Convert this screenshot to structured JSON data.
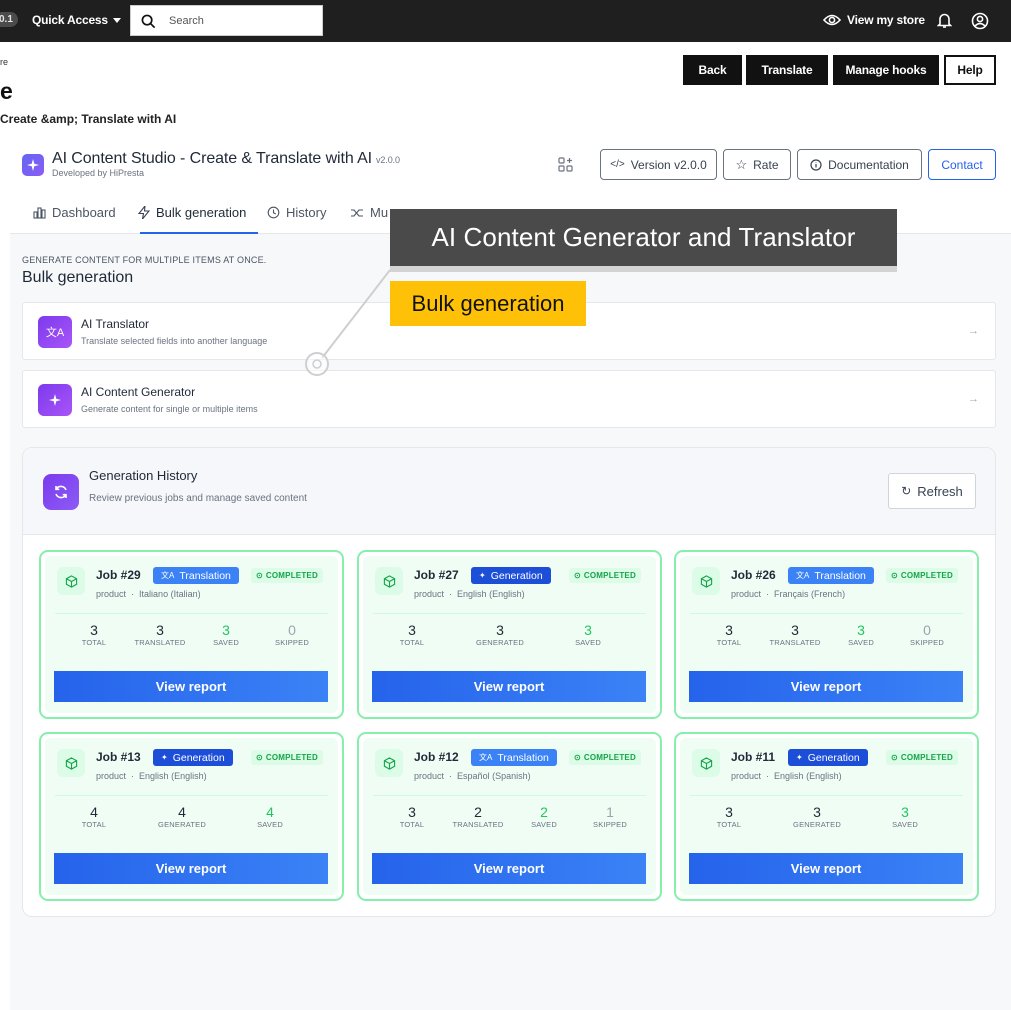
{
  "topbar": {
    "version_badge": "0.1",
    "quick_access": "Quick Access",
    "search_placeholder": "Search",
    "view_store": "View my store"
  },
  "header": {
    "breadcrumb": "re",
    "title": "e",
    "subtitle": "Create &amp; Translate with AI",
    "buttons": [
      "Back",
      "Translate",
      "Manage hooks",
      "Help"
    ]
  },
  "module": {
    "title": "AI Content Studio - Create & Translate with AI",
    "version": "v2.0.0",
    "developer": "Developed by HiPresta",
    "actions": {
      "version_label": "Version v2.0.0",
      "rate_label": "Rate",
      "docs_label": "Documentation",
      "contact_label": "Contact"
    }
  },
  "tabs": [
    {
      "label": "Dashboard",
      "icon": "chart-icon"
    },
    {
      "label": "Bulk generation",
      "icon": "bolt-icon",
      "active": true
    },
    {
      "label": "History",
      "icon": "history-icon"
    },
    {
      "label": "Mu",
      "icon": "shuffle-icon"
    }
  ],
  "section": {
    "kicker": "GENERATE CONTENT FOR MULTIPLE ITEMS AT ONCE.",
    "title": "Bulk generation",
    "cards": [
      {
        "title": "AI Translator",
        "desc": "Translate selected fields into another language",
        "icon": "translate-icon"
      },
      {
        "title": "AI Content Generator",
        "desc": "Generate content for single or multiple items",
        "icon": "sparkle-icon"
      }
    ]
  },
  "history": {
    "title": "Generation History",
    "desc": "Review previous jobs and manage saved content",
    "refresh_label": "Refresh",
    "jobs": [
      {
        "title": "Job #29",
        "type": "Translation",
        "status": "COMPLETED",
        "entity": "product",
        "lang": "Italiano (Italian)",
        "stats": [
          {
            "n": "3",
            "l": "TOTAL"
          },
          {
            "n": "3",
            "l": "TRANSLATED"
          },
          {
            "n": "3",
            "l": "SAVED"
          },
          {
            "n": "0",
            "l": "SKIPPED"
          }
        ],
        "button": "View report"
      },
      {
        "title": "Job #27",
        "type": "Generation",
        "status": "COMPLETED",
        "entity": "product",
        "lang": "English (English)",
        "stats": [
          {
            "n": "3",
            "l": "TOTAL"
          },
          {
            "n": "3",
            "l": "GENERATED"
          },
          {
            "n": "3",
            "l": "SAVED"
          }
        ],
        "button": "View report"
      },
      {
        "title": "Job #26",
        "type": "Translation",
        "status": "COMPLETED",
        "entity": "product",
        "lang": "Français (French)",
        "stats": [
          {
            "n": "3",
            "l": "TOTAL"
          },
          {
            "n": "3",
            "l": "TRANSLATED"
          },
          {
            "n": "3",
            "l": "SAVED"
          },
          {
            "n": "0",
            "l": "SKIPPED"
          }
        ],
        "button": "View report"
      },
      {
        "title": "Job #13",
        "type": "Generation",
        "status": "COMPLETED",
        "entity": "product",
        "lang": "English (English)",
        "stats": [
          {
            "n": "4",
            "l": "TOTAL"
          },
          {
            "n": "4",
            "l": "GENERATED"
          },
          {
            "n": "4",
            "l": "SAVED"
          }
        ],
        "button": "View report"
      },
      {
        "title": "Job #12",
        "type": "Translation",
        "status": "COMPLETED",
        "entity": "product",
        "lang": "Español (Spanish)",
        "stats": [
          {
            "n": "3",
            "l": "TOTAL"
          },
          {
            "n": "2",
            "l": "TRANSLATED"
          },
          {
            "n": "2",
            "l": "SAVED"
          },
          {
            "n": "1",
            "l": "SKIPPED"
          }
        ],
        "button": "View report"
      },
      {
        "title": "Job #11",
        "type": "Generation",
        "status": "COMPLETED",
        "entity": "product",
        "lang": "English (English)",
        "stats": [
          {
            "n": "3",
            "l": "TOTAL"
          },
          {
            "n": "3",
            "l": "GENERATED"
          },
          {
            "n": "3",
            "l": "SAVED"
          }
        ],
        "button": "View report"
      }
    ]
  },
  "annotations": {
    "main": "AI Content Generator and Translator",
    "secondary": "Bulk generation"
  },
  "colors": {
    "accent": "#2563eb",
    "purple": "#7c3aed",
    "success": "#22c55e",
    "callout_dark": "#4a4a4a",
    "callout_yellow": "#ffc107"
  }
}
